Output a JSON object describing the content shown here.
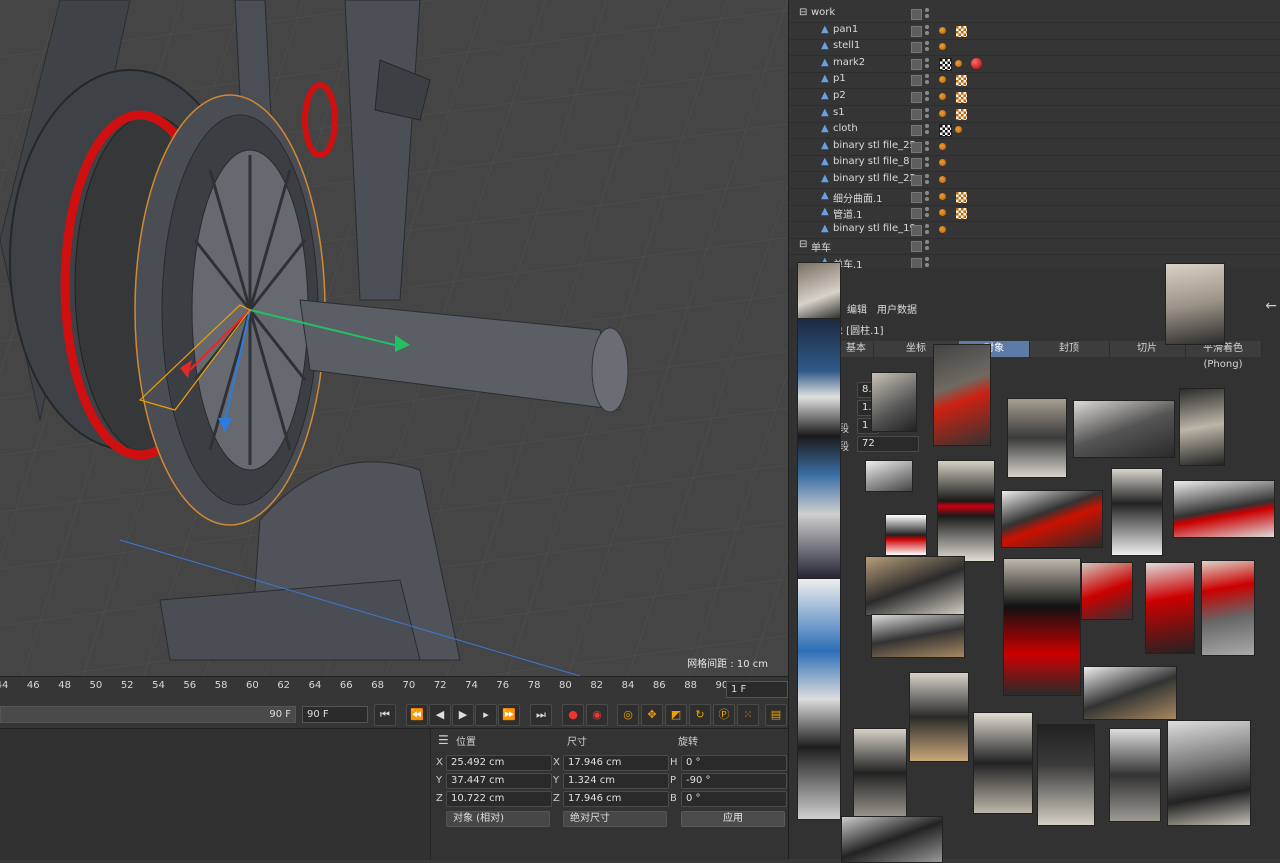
{
  "viewport": {
    "grid_spacing": "网格间距 : 10 cm"
  },
  "timeline": {
    "ticks": [
      "44",
      "46",
      "48",
      "50",
      "52",
      "54",
      "56",
      "58",
      "60",
      "62",
      "64",
      "66",
      "68",
      "70",
      "72",
      "74",
      "76",
      "78",
      "80",
      "82",
      "84",
      "86",
      "88",
      "90"
    ],
    "current_frame": "1 F",
    "end_frame_a": "90 F",
    "end_frame_b": "90 F"
  },
  "coordinates": {
    "headers": {
      "position": "位置",
      "size": "尺寸",
      "rotation": "旋转"
    },
    "rows": [
      {
        "axis": "X",
        "position": "25.492 cm",
        "size_axis": "X",
        "size": "17.946 cm",
        "rot_axis": "H",
        "rotation": "0 °"
      },
      {
        "axis": "Y",
        "position": "37.447 cm",
        "size_axis": "Y",
        "size": "1.324 cm",
        "rot_axis": "P",
        "rotation": "-90 °"
      },
      {
        "axis": "Z",
        "position": "10.722 cm",
        "size_axis": "Z",
        "size": "17.946 cm",
        "rot_axis": "B",
        "rotation": "0 °"
      }
    ],
    "mode_dropdown": "对象 (相对)",
    "size_dropdown": "绝对尺寸",
    "apply_button": "应用"
  },
  "objects": {
    "rows": [
      {
        "name": "work",
        "indent": 0,
        "group": true,
        "tags": []
      },
      {
        "name": "pan1",
        "indent": 1,
        "tags": [
          "phong",
          "check"
        ]
      },
      {
        "name": "stell1",
        "indent": 1,
        "tags": [
          "phong"
        ]
      },
      {
        "name": "mark2",
        "indent": 1,
        "tags": [
          "black",
          "phong",
          "red"
        ]
      },
      {
        "name": "p1",
        "indent": 1,
        "tags": [
          "phong",
          "check"
        ]
      },
      {
        "name": "p2",
        "indent": 1,
        "tags": [
          "phong",
          "check"
        ]
      },
      {
        "name": "s1",
        "indent": 1,
        "tags": [
          "phong",
          "check"
        ]
      },
      {
        "name": "cloth",
        "indent": 1,
        "tags": [
          "black",
          "phong"
        ]
      },
      {
        "name": "binary stl file_25",
        "indent": 1,
        "tags": [
          "phong"
        ]
      },
      {
        "name": "binary stl file_8",
        "indent": 1,
        "tags": [
          "phong"
        ]
      },
      {
        "name": "binary stl file_22",
        "indent": 1,
        "tags": [
          "phong"
        ]
      },
      {
        "name": "细分曲面.1",
        "indent": 1,
        "tags": [
          "phong",
          "check"
        ]
      },
      {
        "name": "管道.1",
        "indent": 1,
        "tags": [
          "phong",
          "check"
        ]
      },
      {
        "name": "binary stl file_19",
        "indent": 1,
        "tags": [
          "phong"
        ]
      },
      {
        "name": "单车",
        "indent": 0,
        "group": true,
        "tags": []
      },
      {
        "name": "单车.1",
        "indent": 1,
        "tags": []
      }
    ]
  },
  "attributes": {
    "menu": [
      "编辑",
      "用户数据"
    ],
    "title": "对象 [圆柱.1]",
    "tabs": [
      "基本",
      "坐标",
      "对象",
      "封顶",
      "切片",
      "平滑着色(Phong)"
    ],
    "field_values": [
      "8.9",
      "1.3",
      "1",
      "72"
    ],
    "field_labels": [
      "段",
      "段"
    ]
  },
  "colors": {
    "selection_tab": "#5c7ca6",
    "viewport_bg": "#454545",
    "accent_red": "#d01010"
  }
}
